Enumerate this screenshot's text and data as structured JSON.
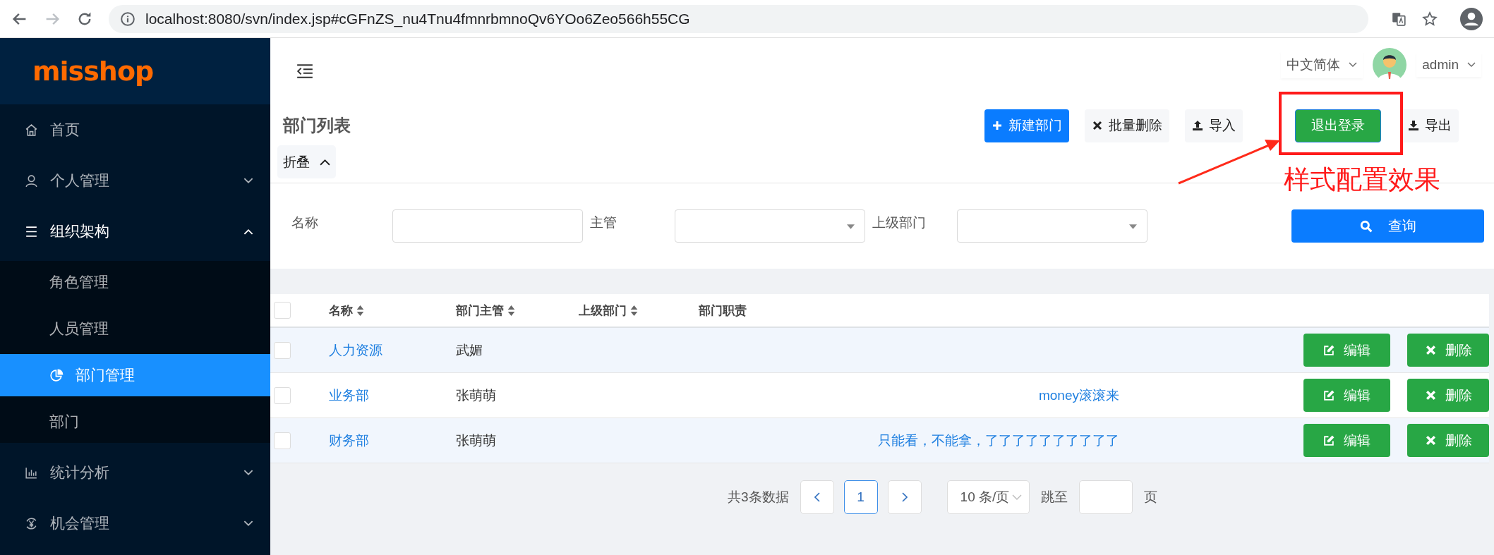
{
  "browser": {
    "url": "localhost:8080/svn/index.jsp#cGFnZS_nu4Tnu4fmnrbmnoQv6YOo6Zeo566h55CG",
    "forward_disabled": true
  },
  "sidebar": {
    "logo": "misshop",
    "items": [
      {
        "label": "首页",
        "kind": "link",
        "selected": false
      },
      {
        "label": "个人管理",
        "kind": "group",
        "expanded": false,
        "selected": false
      },
      {
        "label": "组织架构",
        "kind": "group",
        "expanded": true,
        "selected": false,
        "children": [
          {
            "label": "角色管理",
            "selected": false
          },
          {
            "label": "人员管理",
            "selected": false
          },
          {
            "label": "部门管理",
            "selected": true
          },
          {
            "label": "部门",
            "selected": false
          }
        ]
      },
      {
        "label": "统计分析",
        "kind": "group",
        "expanded": false,
        "selected": false
      },
      {
        "label": "机会管理",
        "kind": "group",
        "expanded": false,
        "selected": false
      }
    ]
  },
  "topbar": {
    "language": "中文简体",
    "user": "admin"
  },
  "page": {
    "title": "部门列表",
    "toolbar": [
      {
        "label": "新建部门",
        "kind": "primary"
      },
      {
        "label": "批量删除",
        "kind": "plain"
      },
      {
        "label": "导入",
        "kind": "plain"
      },
      {
        "label": "退出登录",
        "kind": "success"
      },
      {
        "label": "导出",
        "kind": "plain"
      }
    ],
    "collapse": {
      "label": "折叠",
      "expanded": true
    },
    "annotation": {
      "text": "样式配置效果"
    }
  },
  "filters": {
    "fields": [
      {
        "label": "名称",
        "kind": "text"
      },
      {
        "label": "主管",
        "kind": "select"
      },
      {
        "label": "上级部门",
        "kind": "select"
      }
    ],
    "search_button": "查询"
  },
  "table": {
    "header_checked": false,
    "columns": [
      {
        "label": "名称",
        "sortable": true
      },
      {
        "label": "部门主管",
        "sortable": true
      },
      {
        "label": "上级部门",
        "sortable": true
      },
      {
        "label": "部门职责",
        "sortable": false
      }
    ],
    "rows": [
      {
        "checked": false,
        "name": "人力资源",
        "manager": "武媚",
        "actions": [
          "编辑",
          "删除"
        ]
      },
      {
        "checked": false,
        "name": "业务部",
        "manager": "张萌萌",
        "duty": "money滚滚来",
        "actions": [
          "编辑",
          "删除"
        ]
      },
      {
        "checked": false,
        "name": "财务部",
        "manager": "张萌萌",
        "duty": "只能看，不能拿，了了了了了了了了了了",
        "actions": [
          "编辑",
          "删除"
        ]
      }
    ]
  },
  "pagination": {
    "total": "共3条数据",
    "pages": [
      {
        "label": "1",
        "selected": true
      }
    ],
    "page_size": "10 条/页",
    "jump_label": "跳至",
    "page_suffix": "页"
  }
}
